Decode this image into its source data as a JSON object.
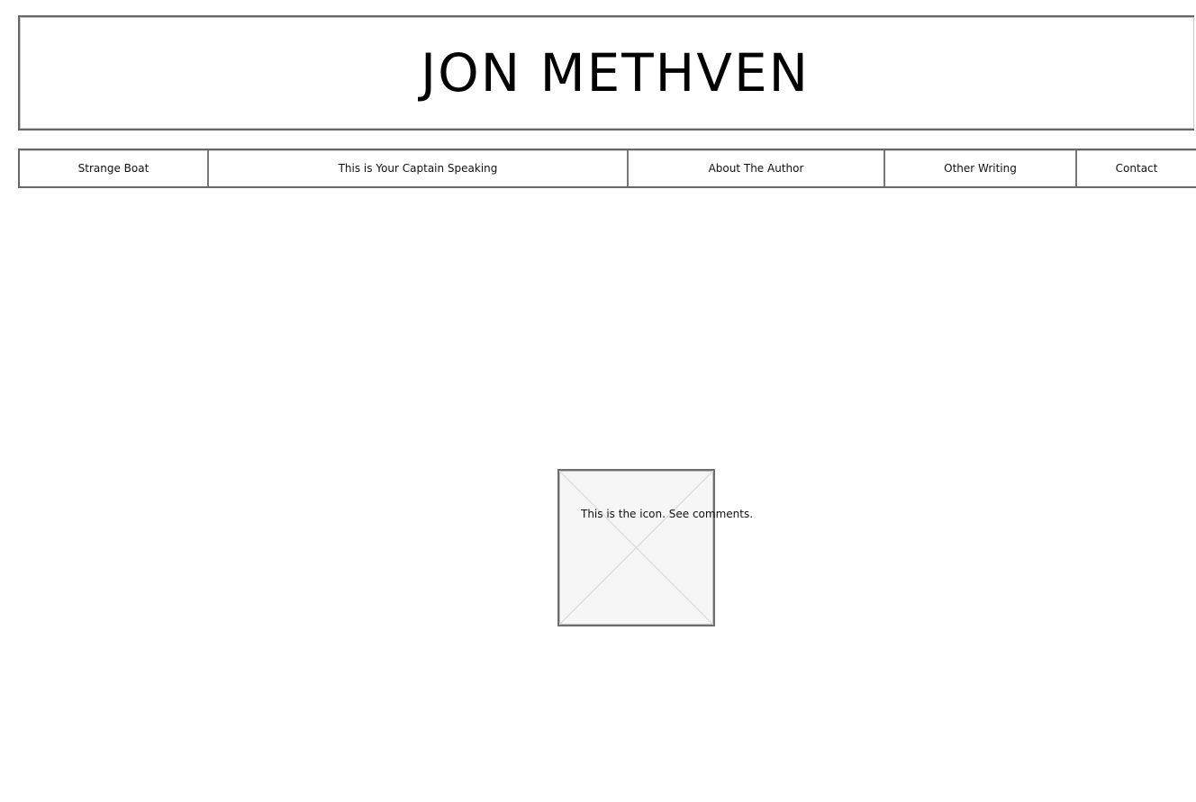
{
  "header": {
    "title": "JON METHVEN"
  },
  "nav": {
    "items": [
      {
        "label": "Strange Boat"
      },
      {
        "label": "This is Your Captain Speaking"
      },
      {
        "label": "About The Author"
      },
      {
        "label": "Other Writing"
      },
      {
        "label": "Contact"
      }
    ]
  },
  "main": {
    "icon_caption": "This is the icon. See comments.",
    "icon_name": "image-placeholder-icon"
  }
}
